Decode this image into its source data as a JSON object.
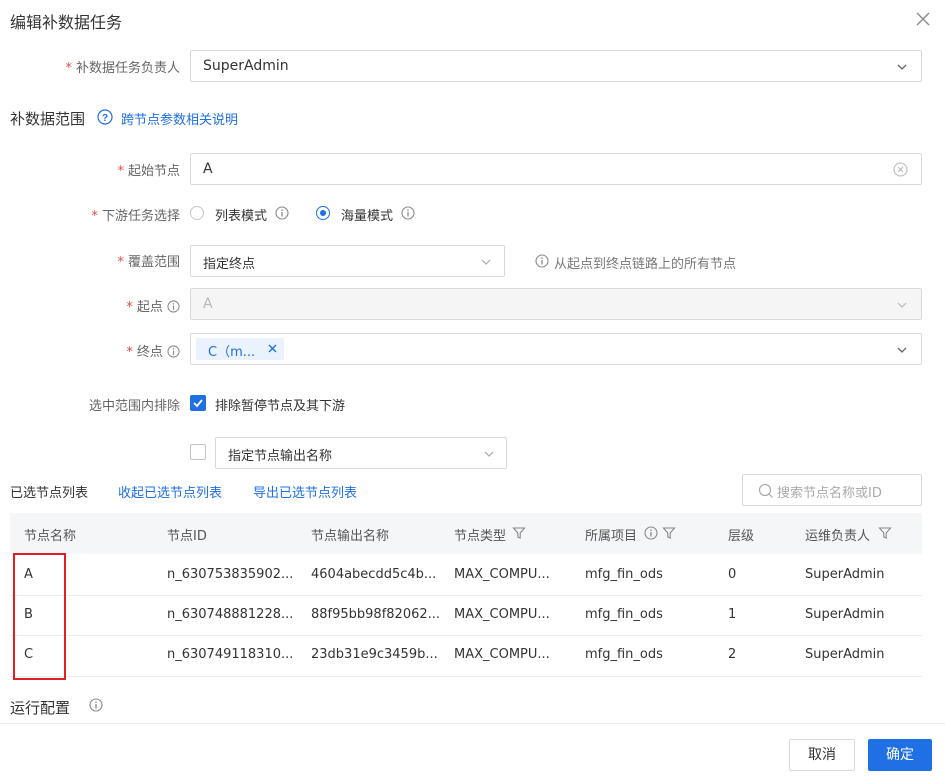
{
  "dialog": {
    "title": "编辑补数据任务",
    "owner": {
      "label": "补数据任务负责人",
      "value": "SuperAdmin"
    },
    "range_section": {
      "title": "补数据范围",
      "help_link": "跨节点参数相关说明"
    },
    "start_node": {
      "label": "起始节点",
      "value": "A"
    },
    "downstream": {
      "label": "下游任务选择",
      "options": [
        {
          "label": "列表模式",
          "selected": false
        },
        {
          "label": "海量模式",
          "selected": true
        }
      ]
    },
    "coverage": {
      "label": "覆盖范围",
      "value": "指定终点",
      "hint": "从起点到终点链路上的所有节点"
    },
    "origin": {
      "label": "起点",
      "value": "A"
    },
    "end": {
      "label": "终点",
      "tag": "C（m..."
    },
    "exclude": {
      "label": "选中范围内排除",
      "pause_option": {
        "label": "排除暂停节点及其下游",
        "checked": true
      },
      "output_option": {
        "checked": false,
        "select_value": "指定节点输出名称"
      }
    },
    "node_list": {
      "title": "已选节点列表",
      "collapse_link": "收起已选节点列表",
      "export_link": "导出已选节点列表",
      "search_placeholder": "搜索节点名称或ID",
      "columns": [
        "节点名称",
        "节点ID",
        "节点输出名称",
        "节点类型",
        "所属项目",
        "层级",
        "运维负责人"
      ],
      "rows": [
        {
          "name": "A",
          "id": "n_630753835902...",
          "output": "4604abecdd5c4b...",
          "type": "MAX_COMPU...",
          "project": "mfg_fin_ods",
          "level": "0",
          "owner": "SuperAdmin"
        },
        {
          "name": "B",
          "id": "n_630748881228...",
          "output": "88f95bb98f82062...",
          "type": "MAX_COMPU...",
          "project": "mfg_fin_ods",
          "level": "1",
          "owner": "SuperAdmin"
        },
        {
          "name": "C",
          "id": "n_630749118310...",
          "output": "23db31e9c3459b...",
          "type": "MAX_COMPU...",
          "project": "mfg_fin_ods",
          "level": "2",
          "owner": "SuperAdmin"
        }
      ]
    },
    "run_config": {
      "title": "运行配置"
    },
    "footer": {
      "cancel": "取消",
      "ok": "确定"
    }
  },
  "colors": {
    "primary": "#1f6fe5",
    "required": "#e84848",
    "highlight_box": "#e02020"
  }
}
